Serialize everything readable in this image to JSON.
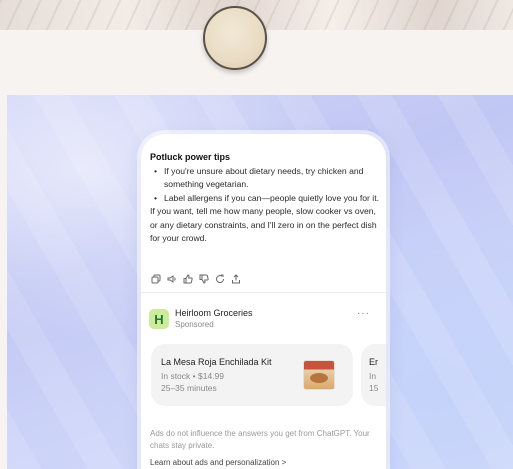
{
  "chat": {
    "heading": "Potluck power tips",
    "bullets": [
      "If you're unsure about dietary needs, try chicken and something vegetarian.",
      "Label allergens if you can—people quietly love you for it."
    ],
    "paragraph": "If you want, tell me how many people, slow cooker vs oven, or any dietary constraints, and I'll zero in on the perfect dish for your crowd."
  },
  "actions": [
    "copy-icon",
    "speaker-icon",
    "thumbs-up-icon",
    "thumbs-down-icon",
    "regenerate-icon",
    "share-icon"
  ],
  "ad": {
    "logo_letter": "H",
    "brand": "Heirloom Groceries",
    "sponsored": "Sponsored",
    "more": "···",
    "products": [
      {
        "title": "La Mesa Roja Enchilada Kit",
        "stock": "In stock • $14.99",
        "eta": "25–35 minutes"
      },
      {
        "title": "Er",
        "stock": "In",
        "eta": "15"
      }
    ],
    "disclaimer": "Ads do not influence the answers you get from ChatGPT. Your chats stay private.",
    "learn_more": "Learn about ads and personalization >"
  },
  "colors": {
    "logo_bg": "#cdeb9b",
    "logo_fg": "#1d7a2e",
    "backdrop": "#c9cff6"
  }
}
